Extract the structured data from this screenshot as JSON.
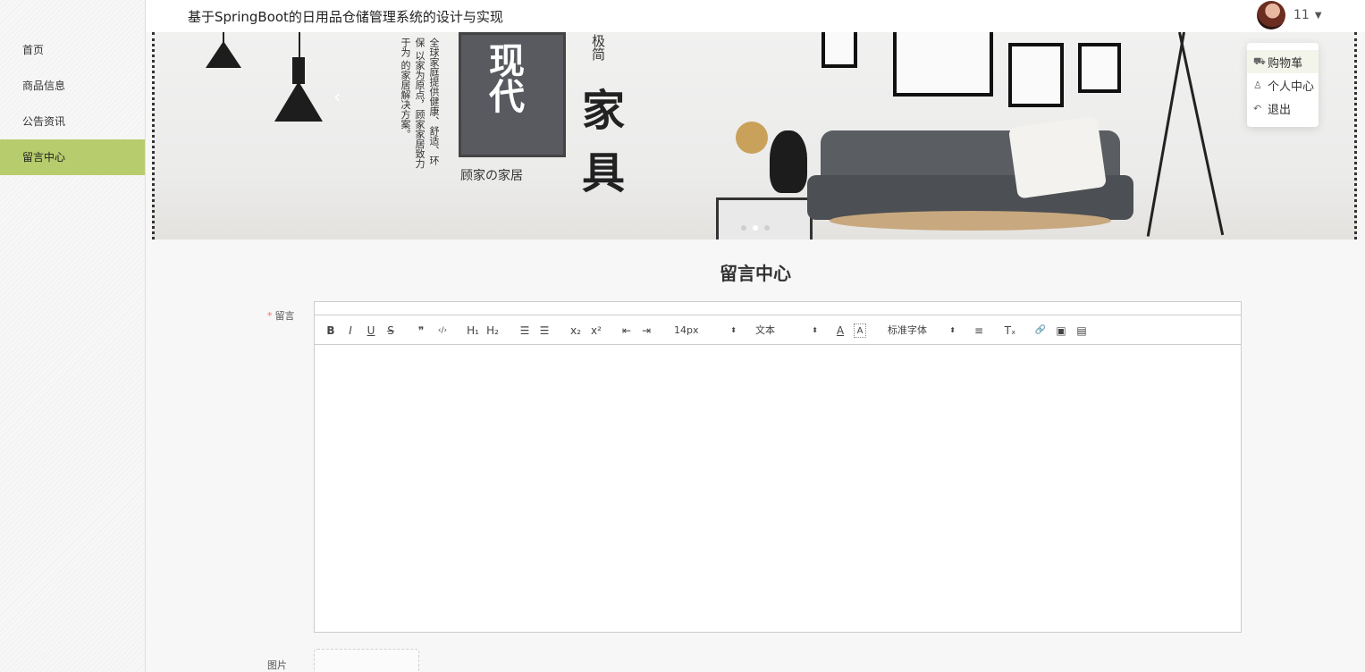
{
  "app": {
    "title": "基于SpringBoot的日用品仓储管理系统的设计与实现"
  },
  "sidebar": {
    "items": [
      {
        "label": "首页",
        "active": false
      },
      {
        "label": "商品信息",
        "active": false
      },
      {
        "label": "公告资讯",
        "active": false
      },
      {
        "label": "留言中心",
        "active": true
      }
    ]
  },
  "header": {
    "user": {
      "name": "11"
    }
  },
  "banner": {
    "poster_text": "现代",
    "brand_top": "极简",
    "chars": [
      "家",
      "具"
    ],
    "vertical_lines": [
      "全球家庭提供健康、舒适、环保",
      "以家为原点，顾家家居致力于为",
      "的家居解决方案。"
    ],
    "sub_brand": "顾家の家居",
    "prev_arrow": "‹"
  },
  "dropdown": {
    "items": [
      {
        "label": "购物车",
        "icon": "truck-icon"
      },
      {
        "label": "个人中心",
        "icon": "user-icon"
      },
      {
        "label": "退出",
        "icon": "logout-icon"
      }
    ]
  },
  "page": {
    "title": "留言中心",
    "message_label": "留言",
    "required_mark": "*",
    "image_label": "图片"
  },
  "editor": {
    "font_size": "14px",
    "header_format": "文本",
    "font_family": "标准字体",
    "tools": {
      "bold": "B",
      "italic": "I",
      "underline": "U",
      "strike": "S",
      "quote": "❞",
      "code": "‹/›",
      "h1": "H₁",
      "h2": "H₂",
      "ordered": "☰",
      "bullet": "☰",
      "sub": "x₂",
      "sup": "x²",
      "outdent": "⇤",
      "indent": "⇥",
      "color": "A",
      "bg": "A",
      "align": "≡",
      "clean": "Tₓ",
      "link": "🔗",
      "image": "▣",
      "video": "▤"
    }
  }
}
